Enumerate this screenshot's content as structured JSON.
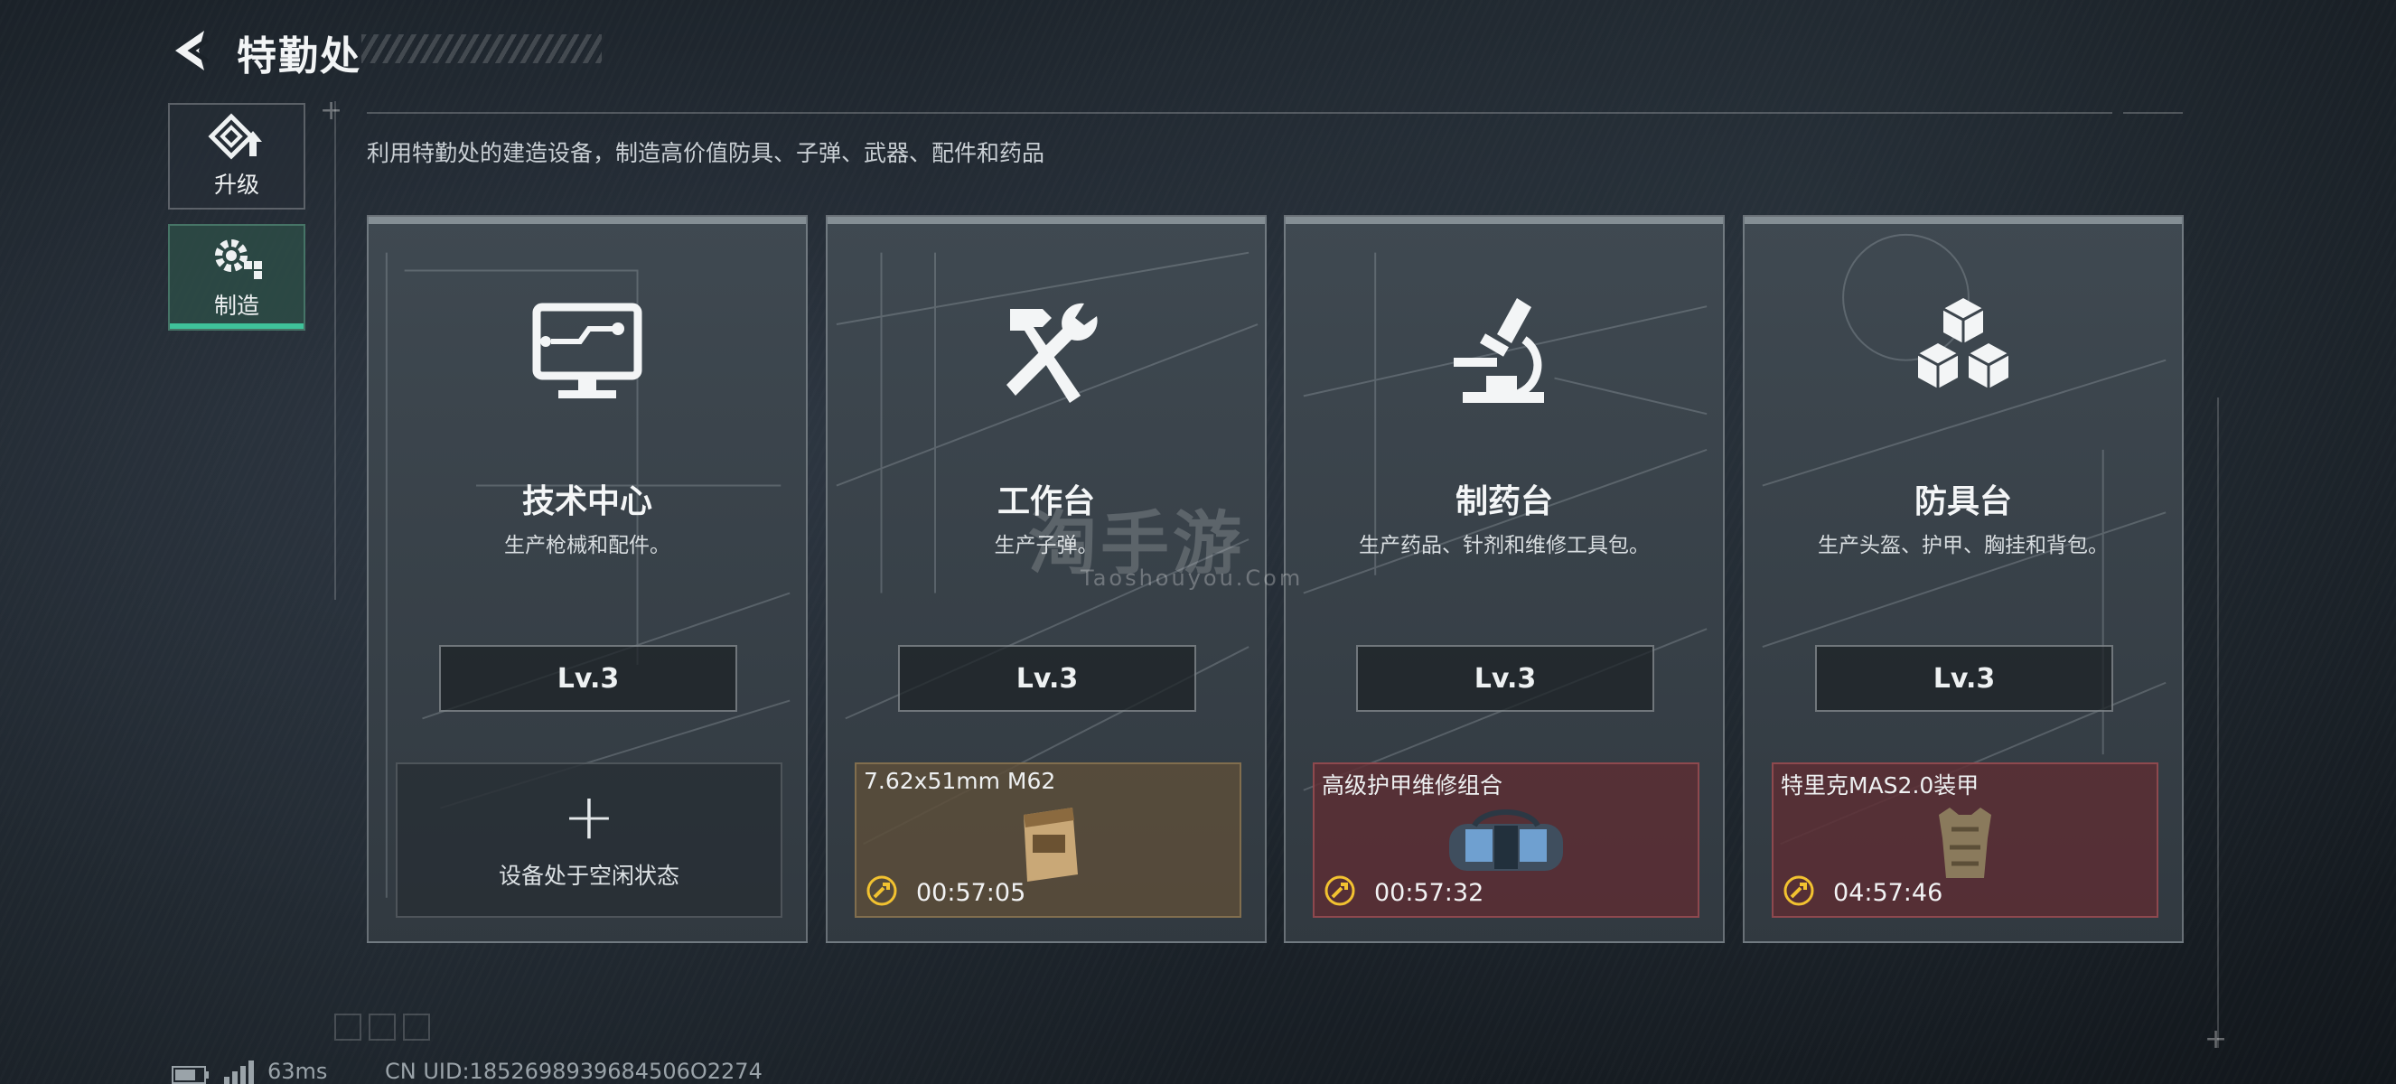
{
  "header": {
    "title": "特勤处"
  },
  "subtitle": "利用特勤处的建造设备，制造高价值防具、子弹、武器、配件和药品",
  "nav": [
    {
      "label": "升级",
      "icon": "upgrade-icon",
      "selected": false
    },
    {
      "label": "制造",
      "icon": "craft-gear-icon",
      "selected": true
    }
  ],
  "stations": [
    {
      "title": "技术中心",
      "desc": "生产枪械和配件。",
      "level": "Lv.3",
      "icon": "monitor-circuit-icon",
      "slot": {
        "state": "idle",
        "idle_text": "设备处于空闲状态"
      }
    },
    {
      "title": "工作台",
      "desc": "生产子弹。",
      "level": "Lv.3",
      "icon": "hammer-wrench-icon",
      "slot": {
        "state": "crafting",
        "item": "7.62x51mm M62",
        "time": "00:57:05",
        "item_icon": "ammo-box-icon",
        "color": "#5c4d3a"
      }
    },
    {
      "title": "制药台",
      "desc": "生产药品、针剂和维修工具包。",
      "level": "Lv.3",
      "icon": "microscope-icon",
      "slot": {
        "state": "crafting",
        "item": "高级护甲维修组合",
        "time": "00:57:32",
        "item_icon": "repair-kit-bag-icon",
        "color": "#5c2e34"
      }
    },
    {
      "title": "防具台",
      "desc": "生产头盔、护甲、胸挂和背包。",
      "level": "Lv.3",
      "icon": "cubes-icon",
      "slot": {
        "state": "crafting",
        "item": "特里克MAS2.0装甲",
        "time": "04:57:46",
        "item_icon": "body-armor-icon",
        "color": "#5c2e34"
      }
    }
  ],
  "watermark": {
    "main": "淘手游",
    "sub": "Taoshouyou.Com"
  },
  "status": {
    "ping": "63ms",
    "uid": "CN UID:1852698939684506O2274"
  },
  "colors": {
    "accent": "#3fc29a",
    "timer_icon": "#f2c230"
  }
}
